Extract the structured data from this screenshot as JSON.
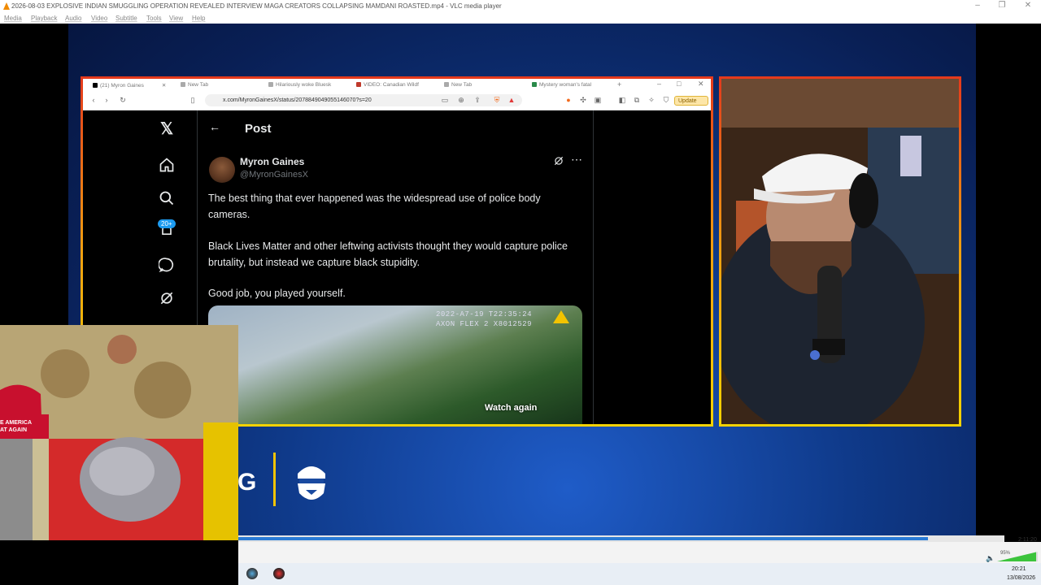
{
  "window": {
    "title": "2026-08-03 EXPLOSIVE INDIAN SMUGGLING OPERATION REVEALED INTERVIEW MAGA CREATORS COLLAPSING MAMDANI ROASTED.mp4 - VLC media player"
  },
  "menu": [
    "Media",
    "Playback",
    "Audio",
    "Video",
    "Subtitle",
    "Tools",
    "View",
    "Help"
  ],
  "browser": {
    "tabs": [
      "(21) Myron Gaines",
      "New Tab",
      "Hilariously woke Bluesk",
      "VIDEO: Canadian Wildf",
      "New Tab",
      "Mystery woman's fatal"
    ],
    "url": "x.com/MyronGainesX/status/2078849049055146070?s=20",
    "update_label": "Update"
  },
  "x": {
    "header": "Post",
    "notif_badge": "20+",
    "author_name": "Myron Gaines",
    "author_handle": "@MyronGainesX",
    "paragraphs": [
      "The best thing that ever happened was the widespread use of police body cameras.",
      "Black Lives Matter and other leftwing activists thought they would capture police brutality, but instead we capture black stupidity.",
      "Good job, you played yourself."
    ],
    "media_overlay_line1": "2022-A7-19 T22:35:24",
    "media_overlay_line2": "AXON FLEX 2 X8012529",
    "watch_again": "Watch again"
  },
  "overlay": {
    "logo_letter": "G"
  },
  "player": {
    "progress": 0.9,
    "total_time": "2:11:20",
    "volume": "95%"
  },
  "taskbar": {
    "time": "20:21",
    "date": "13/08/2026"
  },
  "colors": {
    "border_top": "#e53a1c",
    "border_bottom": "#f5d200",
    "seek": "#2a7bd5",
    "x_bg": "#000000"
  }
}
